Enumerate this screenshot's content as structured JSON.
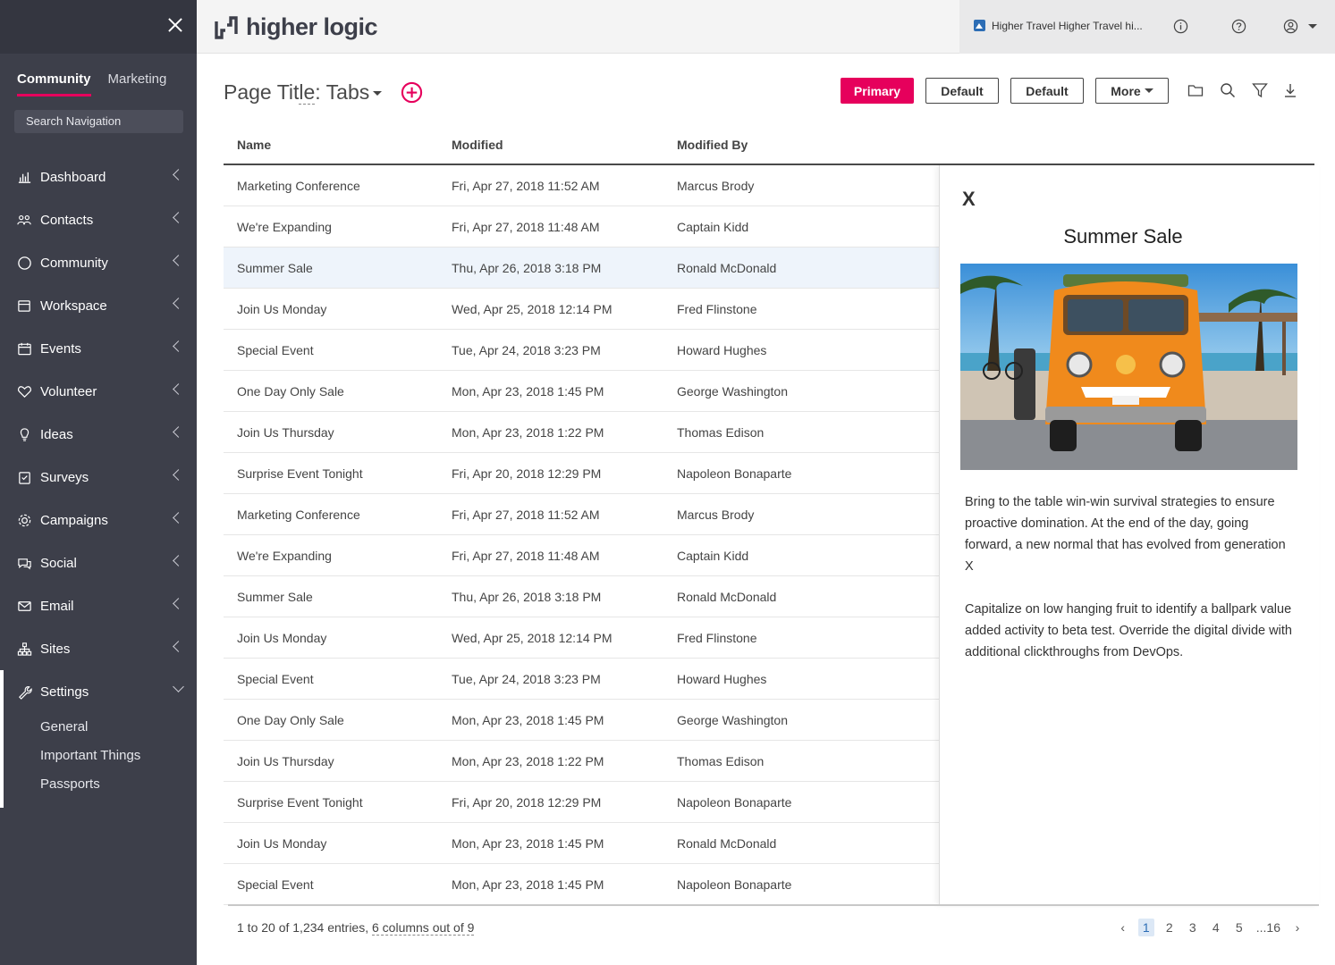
{
  "colors": {
    "accent": "#e6005c",
    "sidebar": "#3d3f4a",
    "selected_row": "#eef4fb"
  },
  "app": {
    "logo_text": "higher logic"
  },
  "account": {
    "name": "Higher Travel Higher Travel hi..."
  },
  "sidebar": {
    "tabs": [
      {
        "label": "Community"
      },
      {
        "label": "Marketing"
      }
    ],
    "search_placeholder": "Search Navigation",
    "items": [
      {
        "label": "Dashboard",
        "icon": "chart-icon"
      },
      {
        "label": "Contacts",
        "icon": "people-icon"
      },
      {
        "label": "Community",
        "icon": "circle-icon"
      },
      {
        "label": "Workspace",
        "icon": "folder-icon"
      },
      {
        "label": "Events",
        "icon": "calendar-icon"
      },
      {
        "label": "Volunteer",
        "icon": "heart-icon"
      },
      {
        "label": "Ideas",
        "icon": "lightbulb-icon"
      },
      {
        "label": "Surveys",
        "icon": "clipboard-icon"
      },
      {
        "label": "Campaigns",
        "icon": "gear-icon"
      },
      {
        "label": "Social",
        "icon": "chat-icon"
      },
      {
        "label": "Email",
        "icon": "envelope-icon"
      },
      {
        "label": "Sites",
        "icon": "sitemap-icon"
      },
      {
        "label": "Settings",
        "icon": "wrench-icon"
      }
    ],
    "settings_subitems": [
      "General",
      "Important Things",
      "Passports"
    ]
  },
  "page": {
    "title_prefix": "Page Tit",
    "title_dotted": "le",
    "title_suffix": ": Tabs",
    "buttons": {
      "primary": "Primary",
      "default1": "Default",
      "default2": "Default",
      "more": "More"
    }
  },
  "table": {
    "headers": {
      "name": "Name",
      "modified": "Modified",
      "modified_by": "Modified By"
    },
    "rows": [
      {
        "name": "Marketing Conference",
        "modified": "Fri, Apr 27, 2018 11:52 AM",
        "by": "Marcus Brody"
      },
      {
        "name": "We're Expanding",
        "modified": "Fri, Apr 27, 2018 11:48 AM",
        "by": "Captain Kidd"
      },
      {
        "name": "Summer Sale",
        "modified": "Thu, Apr 26, 2018 3:18 PM",
        "by": "Ronald McDonald"
      },
      {
        "name": "Join Us Monday",
        "modified": "Wed, Apr 25, 2018 12:14 PM",
        "by": "Fred Flinstone"
      },
      {
        "name": "Special Event",
        "modified": "Tue, Apr 24, 2018 3:23 PM",
        "by": "Howard Hughes"
      },
      {
        "name": "One Day Only Sale",
        "modified": "Mon, Apr 23, 2018 1:45 PM",
        "by": "George Washington"
      },
      {
        "name": "Join Us Thursday",
        "modified": "Mon, Apr 23, 2018 1:22 PM",
        "by": "Thomas Edison"
      },
      {
        "name": "Surprise Event Tonight",
        "modified": "Fri, Apr 20, 2018 12:29 PM",
        "by": "Napoleon Bonaparte"
      },
      {
        "name": "Marketing Conference",
        "modified": "Fri, Apr 27, 2018 11:52 AM",
        "by": "Marcus Brody"
      },
      {
        "name": "We're Expanding",
        "modified": "Fri, Apr 27, 2018 11:48 AM",
        "by": "Captain Kidd"
      },
      {
        "name": "Summer Sale",
        "modified": "Thu, Apr 26, 2018 3:18 PM",
        "by": "Ronald McDonald"
      },
      {
        "name": "Join Us Monday",
        "modified": "Wed, Apr 25, 2018 12:14 PM",
        "by": "Fred Flinstone"
      },
      {
        "name": "Special Event",
        "modified": "Tue, Apr 24, 2018 3:23 PM",
        "by": "Howard Hughes"
      },
      {
        "name": "One Day Only Sale",
        "modified": "Mon, Apr 23, 2018 1:45 PM",
        "by": "George Washington"
      },
      {
        "name": "Join Us Thursday",
        "modified": "Mon, Apr 23, 2018 1:22 PM",
        "by": "Thomas Edison"
      },
      {
        "name": "Surprise Event Tonight",
        "modified": "Fri, Apr 20, 2018 12:29 PM",
        "by": "Napoleon Bonaparte"
      },
      {
        "name": "Join Us Monday",
        "modified": "Mon, Apr 23, 2018 1:45 PM",
        "by": "Ronald McDonald"
      },
      {
        "name": "Special Event",
        "modified": "Mon, Apr 23, 2018 1:45 PM",
        "by": "Napoleon Bonaparte"
      }
    ],
    "selected_index": 2
  },
  "panel": {
    "close": "X",
    "title": "Summer Sale",
    "paragraph1": "Bring to the table win-win survival strategies to ensure proactive domination. At the end of the day, going forward, a new normal that has evolved from generation X",
    "paragraph2": "Capitalize on low hanging fruit to identify a ballpark value added activity to beta test. Override the digital divide with additional clickthroughs from DevOps."
  },
  "footer": {
    "entries_prefix": "1 to 20 of 1,234 entries, ",
    "entries_link": "6 columns out of 9",
    "pages": [
      "1",
      "2",
      "3",
      "4",
      "5",
      "...16"
    ],
    "current_page": "1"
  }
}
